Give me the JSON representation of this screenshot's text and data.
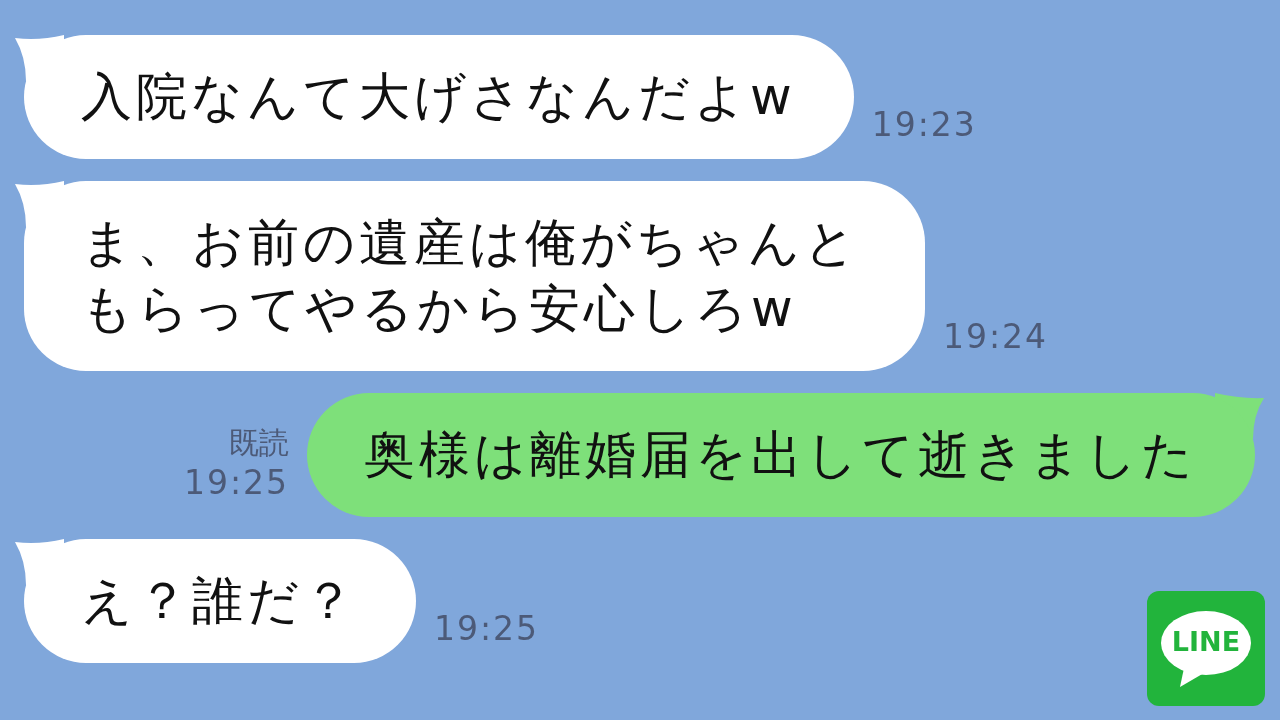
{
  "messages": [
    {
      "kind": "incoming",
      "text": "入院なんて大げさなんだよw",
      "time": "19:23"
    },
    {
      "kind": "incoming",
      "text": "ま、お前の遺産は俺がちゃんともらってやるから安心しろw",
      "time": "19:24"
    },
    {
      "kind": "outgoing",
      "text": "奥様は離婚届を出して逝きました",
      "read": "既読",
      "time": "19:25"
    },
    {
      "kind": "incoming",
      "text": "え？誰だ？",
      "time": "19:25"
    }
  ],
  "logo": {
    "text": "LINE"
  }
}
